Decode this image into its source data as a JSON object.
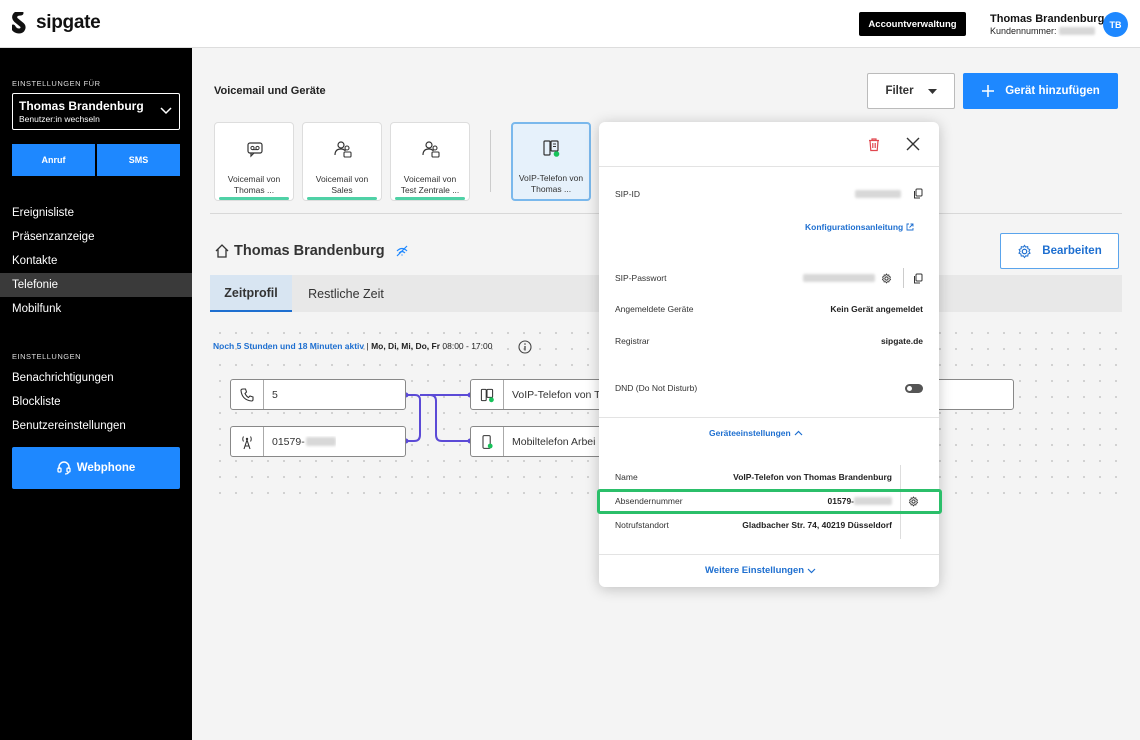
{
  "header": {
    "logo_text": "sipgate",
    "account_button": "Accountverwaltung",
    "user_name": "Thomas Brandenburg",
    "customer_label": "Kundennummer:",
    "avatar_initials": "TB"
  },
  "sidebar": {
    "settings_for": "EINSTELLUNGEN FÜR",
    "selected_user": "Thomas Brandenburg",
    "switch_user": "Benutzer:in wechseln",
    "call_button": "Anruf",
    "sms_button": "SMS",
    "nav": [
      "Ereignisliste",
      "Präsenzanzeige",
      "Kontakte",
      "Telefonie",
      "Mobilfunk"
    ],
    "active_nav": "Telefonie",
    "settings_heading": "EINSTELLUNGEN",
    "settings_nav": [
      "Benachrichtigungen",
      "Blockliste",
      "Benutzereinstellungen"
    ],
    "webphone_button": "Webphone"
  },
  "main": {
    "section_title": "Voicemail und Geräte",
    "filter_button": "Filter",
    "add_device_button": "Gerät hinzufügen",
    "devices": [
      {
        "line1": "Voicemail von",
        "line2": "Thomas ...",
        "icon": "voicemail-icon"
      },
      {
        "line1": "Voicemail von",
        "line2": "Sales",
        "icon": "group-icon"
      },
      {
        "line1": "Voicemail von",
        "line2": "Test Zentrale ...",
        "icon": "group-icon"
      },
      {
        "line1": "VoIP-Telefon von",
        "line2": "Thomas ...",
        "icon": "voip-phone-icon"
      }
    ],
    "person_name": "Thomas Brandenburg",
    "edit_button": "Bearbeiten",
    "tabs": [
      "Zeitprofil",
      "Restliche Zeit"
    ],
    "active_tab": "Zeitprofil",
    "schedule_active": "Noch 5 Stunden und 18 Minuten aktiv",
    "schedule_sep": " | ",
    "schedule_days": "Mo, Di, Mi, Do, Fr",
    "schedule_time": " 08:00 - 17:00",
    "flow": {
      "source1": "5",
      "source2_prefix": "01579-",
      "target1": "VoIP-Telefon von T",
      "target2": "Mobiltelefon Arbei"
    }
  },
  "popover": {
    "sip_id_label": "SIP-ID",
    "config_link": "Konfigurationsanleitung",
    "sip_password_label": "SIP-Passwort",
    "registered_label": "Angemeldete Geräte",
    "registered_value": "Kein Gerät angemeldet",
    "registrar_label": "Registrar",
    "registrar_value": "sipgate.de",
    "dnd_label": "DND (Do Not Disturb)",
    "device_settings_link": "Geräteeinstellungen",
    "name_label": "Name",
    "name_value": "VoIP-Telefon von Thomas Brandenburg",
    "sender_label": "Absendernummer",
    "sender_prefix": "01579-",
    "emergency_label": "Notrufstandort",
    "emergency_value": "Gladbacher Str. 74, 40219 Düsseldorf",
    "more_settings_link": "Weitere Einstellungen"
  },
  "colors": {
    "accent_blue": "#1e88ff",
    "link_blue": "#1e6fd0",
    "status_green": "#4fd1a6",
    "highlight_green": "#2bbf6a",
    "delete_red": "#e0464e"
  }
}
